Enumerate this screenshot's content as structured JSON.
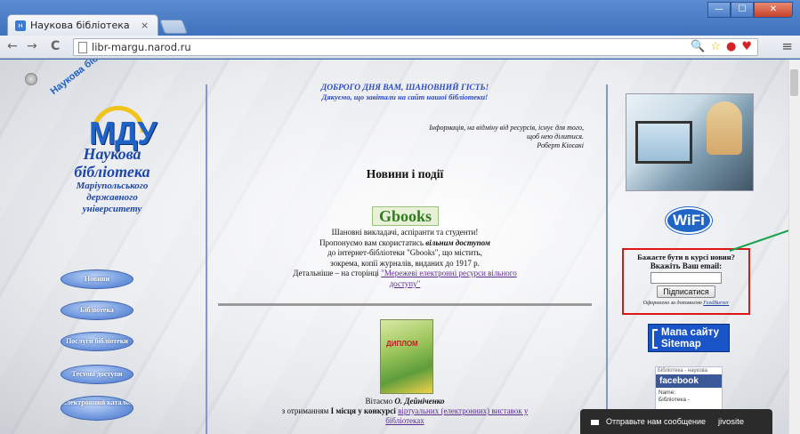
{
  "browser": {
    "tab_title": "Наукова бібліотека",
    "tab_close": "×",
    "url": "libr-margu.narod.ru",
    "back": "←",
    "forward": "→",
    "reload": "C",
    "menu": "≡",
    "window_minimize": "—",
    "window_maximize": "☐",
    "window_close": "✕"
  },
  "sidebar": {
    "logo_arc_text": "Наукова бібліотека",
    "logo_text": "МДУ",
    "title": "Наукова бібліотека",
    "subtitle": "Маріупольського державного університету",
    "nav": [
      "Новини",
      "Бібліотека",
      "Послуги бібліотеки",
      "Тестові доступи",
      "Електронний каталог"
    ]
  },
  "main": {
    "greeting": "ДОБРОГО ДНЯ ВАМ, ШАНОВНИЙ ГІСТЬ!",
    "greeting_sub": "Дякуємо, що завітали на сайт нашої бібліотеки!",
    "quote": "Інформація, на відміну від ресурсів, існує для того, щоб нею ділитися.",
    "quote_author": "Роберт Кіосакі",
    "news_title": "Новини і події",
    "gbooks_logo": "Gbooks",
    "gbooks_line1": "Шановні викладачі, аспіранти та студенти!",
    "gbooks_line2_a": "Пропонуємо вам скористатись ",
    "gbooks_line2_b": "вільним доступом",
    "gbooks_line3": "до інтернет-бібліотеки \"Gbooks\", що містить,",
    "gbooks_line4": "зокрема, копії журналів, виданих до 1917 р.",
    "gbooks_line5": "Детальніше – на сторінці ",
    "gbooks_link": "\"Мережеві електронні ресурси вільного доступу\"",
    "diploma_label": "ДИПЛОМ",
    "award_a": "Вітаємо ",
    "award_name": "О. Дейнiченко",
    "award_b": "з отриманням ",
    "award_place": "І місця у конкурсі ",
    "award_link": "віртуальних (електронних) виставок у бібліотеках"
  },
  "right": {
    "wifi": "WiFi",
    "subscribe_line1": "Бажаєте бути в курсі новин?",
    "subscribe_line2": "Вкажіть Ваш email:",
    "email_value": "",
    "subscribe_button": "Підписатися",
    "powered_text": "Оформлено за допомогою ",
    "powered_link": "FeedBurner",
    "sitemap_line1": "Мапа сайту",
    "sitemap_line2": "Sitemap",
    "fb_header": "Бібліотека - наукова",
    "fb_logo": "facebook",
    "fb_name_label": "Name:",
    "fb_name": "Бібліотека -"
  },
  "chat": {
    "label": "Отправьте нам сообщение",
    "brand": "jivosite"
  },
  "colors": {
    "accent_blue": "#1f63c6",
    "highlight_red": "#e01515",
    "arrow_green": "#17a34a"
  }
}
